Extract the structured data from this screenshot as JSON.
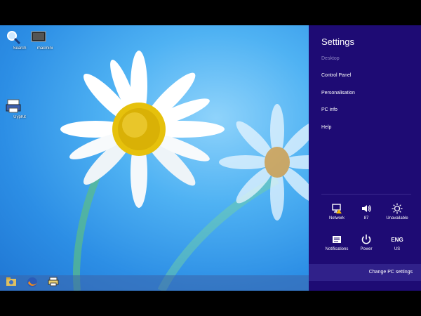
{
  "desktop": {
    "icons": [
      {
        "label": "Search"
      },
      {
        "label": "macmini"
      },
      {
        "label": "UypKit"
      }
    ],
    "wallpaper_colors": {
      "sky": "#3aa2ee",
      "petal": "#ffffff",
      "center": "#e6c10c"
    }
  },
  "taskbar": {
    "buttons": [
      "explorer",
      "firefox",
      "app"
    ]
  },
  "settings": {
    "title": "Settings",
    "context": "Desktop",
    "links": [
      "Control Panel",
      "Personalisation",
      "PC info",
      "Help"
    ],
    "quick": [
      {
        "icon": "network-icon",
        "label": "Network"
      },
      {
        "icon": "volume-icon",
        "label": "87"
      },
      {
        "icon": "brightness-icon",
        "label": "Unavailable"
      },
      {
        "icon": "notifications-icon",
        "label": "Notifications"
      },
      {
        "icon": "power-icon",
        "label": "Power"
      },
      {
        "icon": "language-icon",
        "label": "US",
        "code": "ENG"
      }
    ],
    "change_pc": "Change PC settings",
    "accent": "#1e0b74"
  }
}
